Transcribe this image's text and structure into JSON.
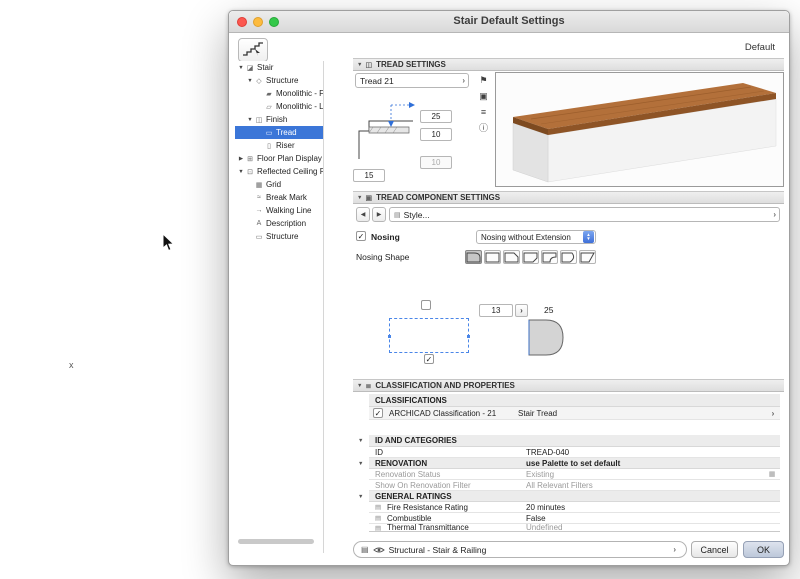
{
  "artifacts": {
    "stray_mark": "x"
  },
  "window": {
    "title": "Stair Default Settings",
    "default_label": "Default"
  },
  "tree": {
    "items": [
      {
        "label": "Stair"
      },
      {
        "label": "Structure"
      },
      {
        "label": "Monolithic - Flight"
      },
      {
        "label": "Monolithic - Landing"
      },
      {
        "label": "Finish"
      },
      {
        "label": "Tread"
      },
      {
        "label": "Riser"
      },
      {
        "label": "Floor Plan Display"
      },
      {
        "label": "Reflected Ceiling Plan Displ"
      },
      {
        "label": "Grid"
      },
      {
        "label": "Break Mark"
      },
      {
        "label": "Walking Line"
      },
      {
        "label": "Description"
      },
      {
        "label": "Structure"
      }
    ]
  },
  "tread_settings": {
    "header": "TREAD SETTINGS",
    "preset": "Tread 21",
    "dim_top": "25",
    "dim_mid": "10",
    "dim_disabled": "10",
    "dim_width": "15"
  },
  "component": {
    "header": "TREAD COMPONENT SETTINGS",
    "style_label": "Style...",
    "nosing_label": "Nosing",
    "nosing_type": "Nosing without Extension",
    "shape_label": "Nosing Shape",
    "depth": "13",
    "radius_label": "25"
  },
  "properties": {
    "header": "CLASSIFICATION AND PROPERTIES",
    "classifications_title": "CLASSIFICATIONS",
    "classification_name": "ARCHICAD Classification - 21",
    "classification_value": "Stair Tread",
    "id_section": "ID AND CATEGORIES",
    "id_label": "ID",
    "id_value": "TREAD-040",
    "renovation_section": "RENOVATION",
    "renovation_note": "use Palette to set default",
    "renovation_status_label": "Renovation Status",
    "renovation_status_value": "Existing",
    "show_filter_label": "Show On Renovation Filter",
    "show_filter_value": "All Relevant Filters",
    "ratings_section": "GENERAL RATINGS",
    "fire_label": "Fire Resistance Rating",
    "fire_value": "20 minutes",
    "combustible_label": "Combustible",
    "combustible_value": "False",
    "thermal_label": "Thermal Transmittance",
    "thermal_value": "Undefined"
  },
  "footer": {
    "layer": "Structural - Stair & Railing",
    "cancel": "Cancel",
    "ok": "OK"
  }
}
